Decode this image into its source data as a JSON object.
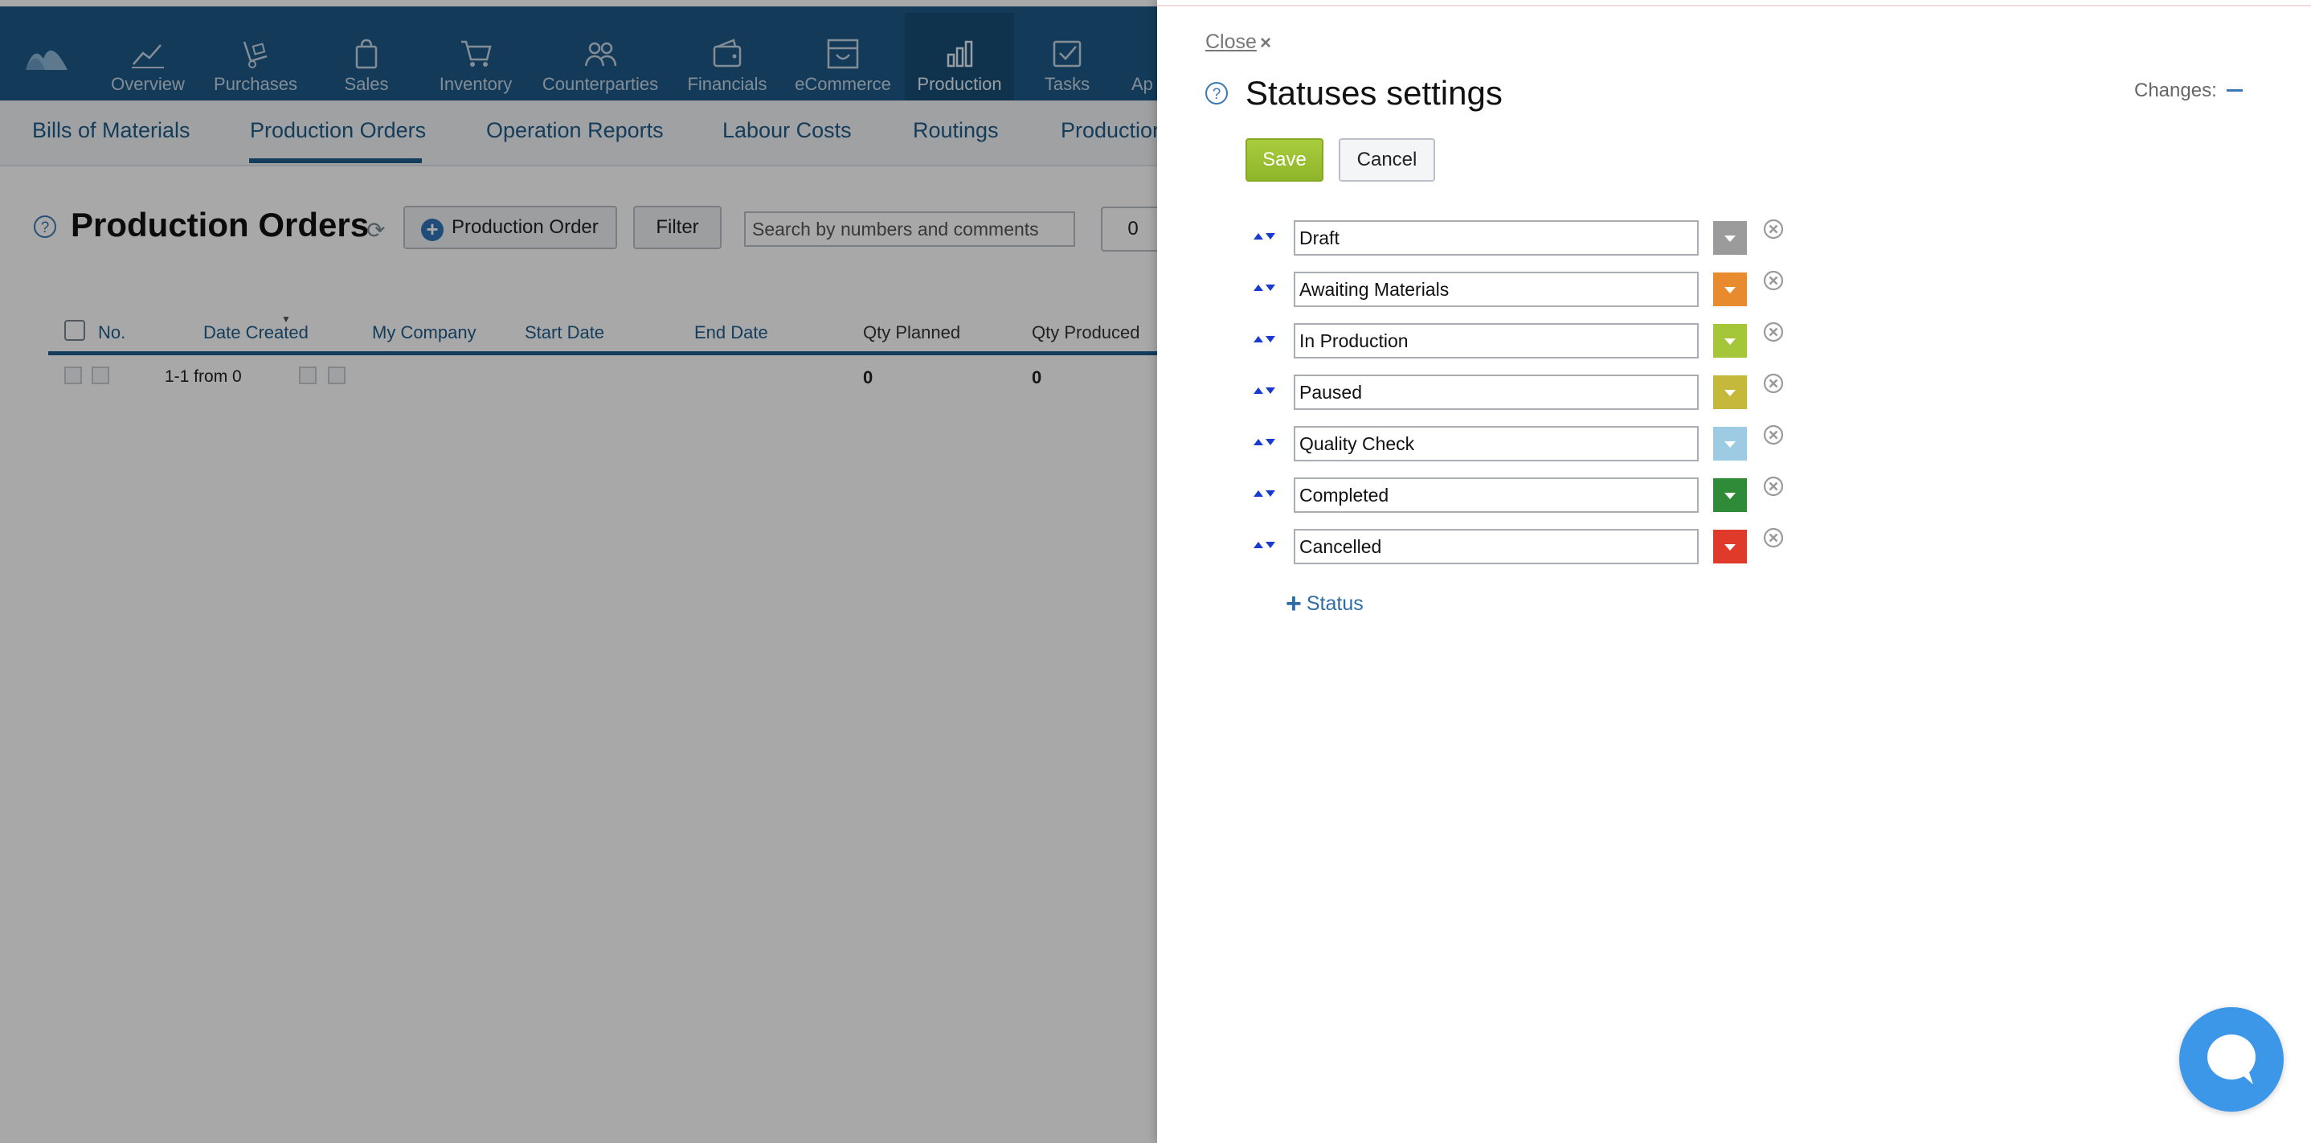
{
  "nav": {
    "items": [
      {
        "label": "Overview",
        "icon": "chart-line-icon"
      },
      {
        "label": "Purchases",
        "icon": "hand-truck-icon"
      },
      {
        "label": "Sales",
        "icon": "shopping-bag-icon"
      },
      {
        "label": "Inventory",
        "icon": "cart-icon"
      },
      {
        "label": "Counterparties",
        "icon": "people-icon"
      },
      {
        "label": "Financials",
        "icon": "wallet-icon"
      },
      {
        "label": "eCommerce",
        "icon": "storefront-icon"
      },
      {
        "label": "Production",
        "icon": "bar-chart-icon"
      },
      {
        "label": "Tasks",
        "icon": "checkbox-icon"
      },
      {
        "label": "Ap",
        "icon": "apps-icon"
      }
    ],
    "active": "Production"
  },
  "subnav": {
    "items": [
      "Bills of Materials",
      "Production Orders",
      "Operation Reports",
      "Labour Costs",
      "Routings",
      "Production"
    ],
    "active": "Production Orders"
  },
  "page": {
    "title": "Production Orders",
    "new_button": "Production Order",
    "filter_button": "Filter",
    "search_placeholder": "Search by numbers and comments",
    "counter": "0"
  },
  "table": {
    "columns": [
      "No.",
      "Date Created",
      "My Company",
      "Start Date",
      "End Date",
      "Qty Planned",
      "Qty Produced"
    ],
    "pager": "1-1 from 0",
    "totals": {
      "qty_planned": "0",
      "qty_produced": "0"
    }
  },
  "panel": {
    "close_label": "Close",
    "title": "Statuses settings",
    "changes_label": "Changes:",
    "save_label": "Save",
    "cancel_label": "Cancel",
    "add_status_label": "Status",
    "statuses": [
      {
        "name": "Draft",
        "color": "#9b9b9b"
      },
      {
        "name": "Awaiting Materials",
        "color": "#e88a2e"
      },
      {
        "name": "In Production",
        "color": "#a6c63a"
      },
      {
        "name": "Paused",
        "color": "#c4b93a"
      },
      {
        "name": "Quality Check",
        "color": "#9ccbe3"
      },
      {
        "name": "Completed",
        "color": "#2f8b38"
      },
      {
        "name": "Cancelled",
        "color": "#e03a2b"
      }
    ]
  },
  "colors": {
    "topbar": "#1d5a88",
    "accent": "#1f5b8a",
    "save": "#98bd30",
    "chat": "#3d97e8"
  }
}
